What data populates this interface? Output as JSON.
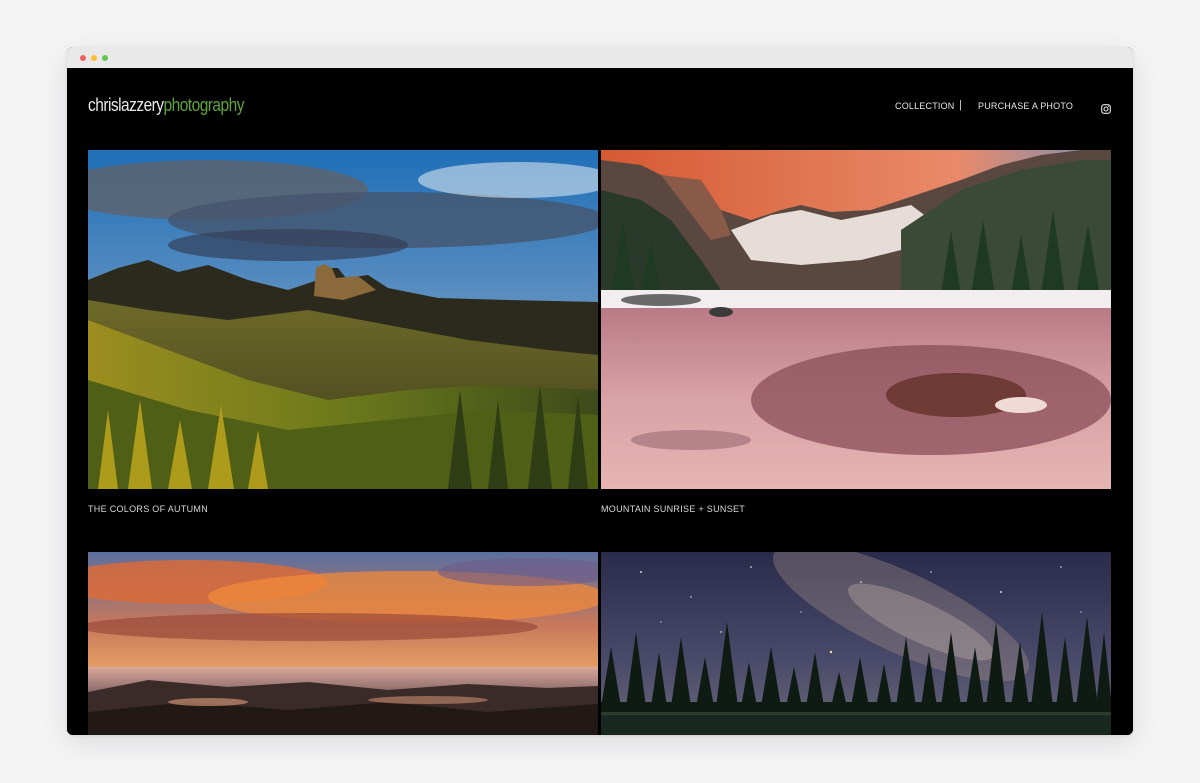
{
  "window": {
    "chrome_dots": [
      "close",
      "minimize",
      "maximize"
    ]
  },
  "header": {
    "logo_part1": "chrislazzery",
    "logo_part2": "photography",
    "nav": {
      "collection": "COLLECTION",
      "separator": "|",
      "purchase": "PURCHASE A PHOTO"
    },
    "social_icon": "instagram-icon"
  },
  "gallery": {
    "items": [
      {
        "caption": "THE COLORS OF AUTUMN"
      },
      {
        "caption": "MOUNTAIN SUNRISE + SUNSET"
      },
      {
        "caption": ""
      },
      {
        "caption": ""
      }
    ]
  },
  "colors": {
    "background": "#000000",
    "brand_green": "#5fa53a",
    "nav_text": "#e8e8e8",
    "page_bg": "#f4f4f5"
  }
}
